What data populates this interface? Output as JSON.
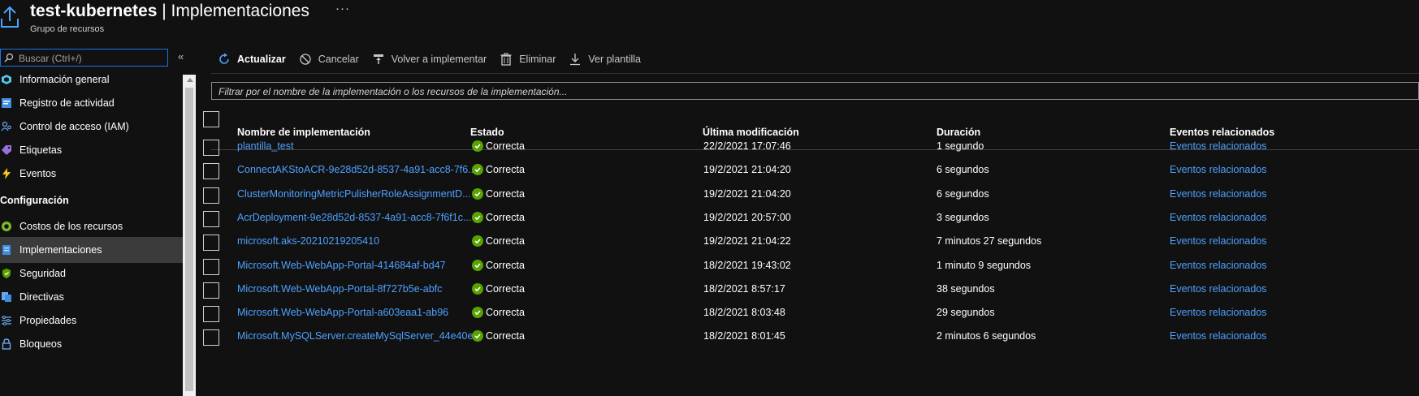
{
  "header": {
    "resource_name": "test-kubernetes",
    "separator": " | ",
    "page_title": "Implementaciones",
    "subtitle": "Grupo de recursos",
    "more": "···"
  },
  "sidebar": {
    "search_placeholder": "Buscar (Ctrl+/)",
    "collapse": "«",
    "items_top": [
      {
        "label": "Información general",
        "icon": "resource-group-icon"
      },
      {
        "label": "Registro de actividad",
        "icon": "activity-log-icon"
      },
      {
        "label": "Control de acceso (IAM)",
        "icon": "iam-icon"
      },
      {
        "label": "Etiquetas",
        "icon": "tag-icon"
      },
      {
        "label": "Eventos",
        "icon": "lightning-icon"
      }
    ],
    "section_title": "Configuración",
    "items_config": [
      {
        "label": "Costos de los recursos",
        "icon": "cost-icon"
      },
      {
        "label": "Implementaciones",
        "icon": "deployment-icon",
        "active": true
      },
      {
        "label": "Seguridad",
        "icon": "shield-icon"
      },
      {
        "label": "Directivas",
        "icon": "policy-icon"
      },
      {
        "label": "Propiedades",
        "icon": "properties-icon"
      },
      {
        "label": "Bloqueos",
        "icon": "lock-icon"
      }
    ]
  },
  "toolbar": {
    "refresh": "Actualizar",
    "cancel": "Cancelar",
    "redeploy": "Volver a implementar",
    "delete": "Eliminar",
    "view_template": "Ver plantilla"
  },
  "filter": {
    "placeholder": "Filtrar por el nombre de la implementación o los recursos de la implementación..."
  },
  "table": {
    "columns": [
      "Nombre de implementación",
      "Estado",
      "Última modificación",
      "Duración",
      "Eventos relacionados"
    ],
    "rows": [
      {
        "name": "plantilla_test",
        "status": "Correcta",
        "modified": "22/2/2021 17:07:46",
        "duration": "1 segundo",
        "events": "Eventos relacionados"
      },
      {
        "name": "ConnectAKStoACR-9e28d52d-8537-4a91-acc8-7f6...",
        "status": "Correcta",
        "modified": "19/2/2021 21:04:20",
        "duration": "6 segundos",
        "events": "Eventos relacionados"
      },
      {
        "name": "ClusterMonitoringMetricPulisherRoleAssignmentD...",
        "status": "Correcta",
        "modified": "19/2/2021 21:04:20",
        "duration": "6 segundos",
        "events": "Eventos relacionados"
      },
      {
        "name": "AcrDeployment-9e28d52d-8537-4a91-acc8-7f6f1c...",
        "status": "Correcta",
        "modified": "19/2/2021 20:57:00",
        "duration": "3 segundos",
        "events": "Eventos relacionados"
      },
      {
        "name": "microsoft.aks-20210219205410",
        "status": "Correcta",
        "modified": "19/2/2021 21:04:22",
        "duration": "7 minutos 27 segundos",
        "events": "Eventos relacionados"
      },
      {
        "name": "Microsoft.Web-WebApp-Portal-414684af-bd47",
        "status": "Correcta",
        "modified": "18/2/2021 19:43:02",
        "duration": "1 minuto 9 segundos",
        "events": "Eventos relacionados"
      },
      {
        "name": "Microsoft.Web-WebApp-Portal-8f727b5e-abfc",
        "status": "Correcta",
        "modified": "18/2/2021 8:57:17",
        "duration": "38 segundos",
        "events": "Eventos relacionados"
      },
      {
        "name": "Microsoft.Web-WebApp-Portal-a603eaa1-ab96",
        "status": "Correcta",
        "modified": "18/2/2021 8:03:48",
        "duration": "29 segundos",
        "events": "Eventos relacionados"
      },
      {
        "name": "Microsoft.MySQLServer.createMySqlServer_44e40e...",
        "status": "Correcta",
        "modified": "18/2/2021 8:01:45",
        "duration": "2 minutos 6 segundos",
        "events": "Eventos relacionados"
      }
    ]
  },
  "colors": {
    "background": "#111111",
    "link": "#4ea1ff",
    "success": "#57a300",
    "accent": "#1a73e8"
  }
}
